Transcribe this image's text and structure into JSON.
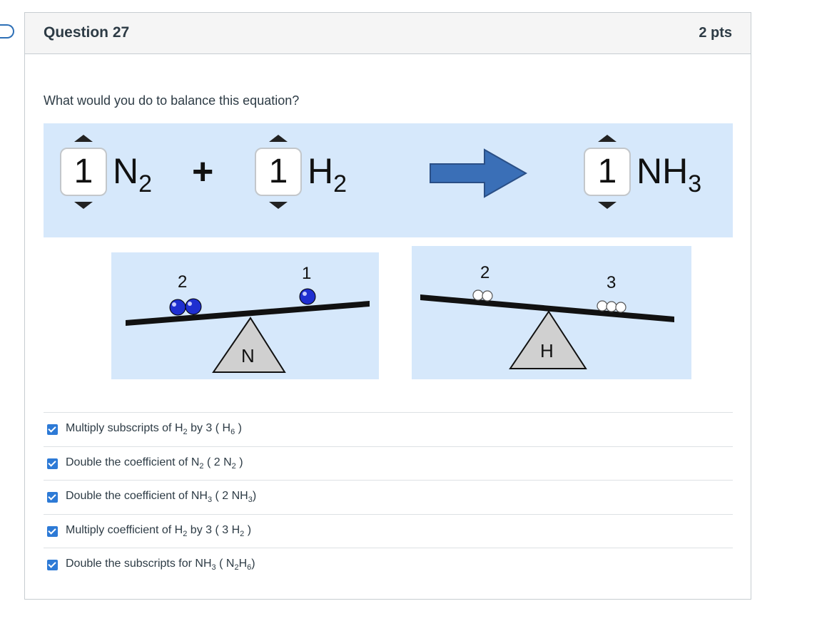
{
  "question": {
    "title": "Question 27",
    "points": "2 pts",
    "prompt": "What would you do to balance this equation?"
  },
  "equation": {
    "reactant1": {
      "coefficient": "1",
      "symbol": "N",
      "subscript": "2"
    },
    "plus": "+",
    "reactant2": {
      "coefficient": "1",
      "symbol": "H",
      "subscript": "2"
    },
    "product": {
      "coefficient": "1",
      "symbol": "NH",
      "subscript": "3"
    },
    "arrow_color": "#3a6fb7"
  },
  "balances": [
    {
      "element": "N",
      "left_count": "2",
      "right_count": "1",
      "atom_color": "#1f2fd0"
    },
    {
      "element": "H",
      "left_count": "2",
      "right_count": "3",
      "atom_color": "#ffffff"
    }
  ],
  "answers": [
    {
      "pre": "Multiply subscripts of H",
      "sub1": "2",
      "mid": " by 3 ( H",
      "sub2": "6",
      "post": " )",
      "checked": true
    },
    {
      "pre": "Double the coefficient of N",
      "sub1": "2",
      "mid": " ( 2 N",
      "sub2": "2",
      "post": " )",
      "checked": true
    },
    {
      "pre": "Double the coefficient of NH",
      "sub1": "3",
      "mid": " ( 2 NH",
      "sub2": "3",
      "post": ")",
      "checked": true
    },
    {
      "pre": "Multiply coefficient of H",
      "sub1": "2",
      "mid": " by 3 ( 3 H",
      "sub2": "2",
      "post": " )",
      "checked": true
    },
    {
      "pre": "Double the subscripts for NH",
      "sub1": "3",
      "mid": " ( N",
      "sub2": "2",
      "mid2": "H",
      "sub3": "6",
      "post": ")",
      "checked": true
    }
  ],
  "colors": {
    "panel_bg": "#d6e8fb",
    "checkbox": "#2d7ad6",
    "text": "#2d3b45"
  }
}
